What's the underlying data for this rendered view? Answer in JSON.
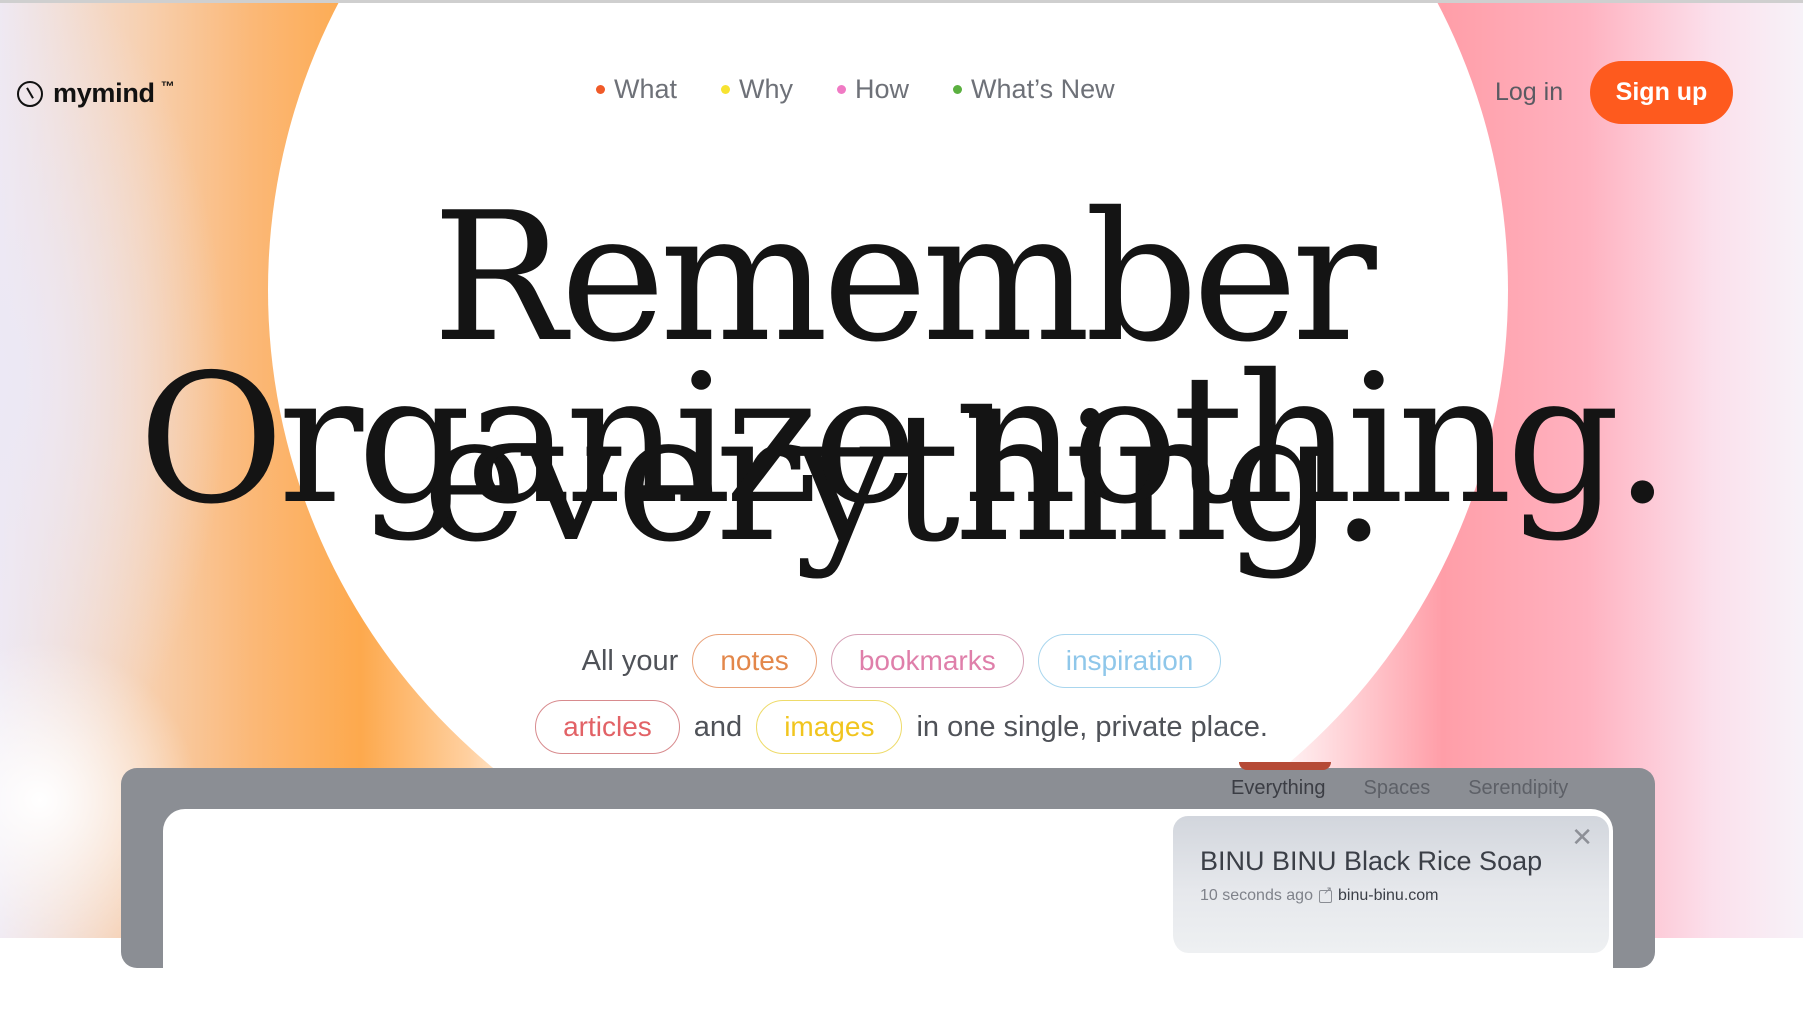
{
  "brand": {
    "name": "mymind",
    "tm": "™",
    "icon": "mind-clock-icon"
  },
  "nav": {
    "items": [
      {
        "label": "What",
        "dot_color": "#f05a28"
      },
      {
        "label": "Why",
        "dot_color": "#f7e331"
      },
      {
        "label": "How",
        "dot_color": "#f07ac4"
      },
      {
        "label": "What’s New",
        "dot_color": "#5bb040"
      }
    ]
  },
  "auth": {
    "login_label": "Log in",
    "signup_label": "Sign up",
    "accent": "#fe5a1e"
  },
  "hero": {
    "line1": "Remember everything.",
    "line2": "Organize nothing.",
    "sub_prefix": "All your",
    "sub_and": "and",
    "sub_suffix": "in one single, private place.",
    "pills": [
      {
        "label": "notes",
        "color": "#e3874a",
        "border": "#e9a27a"
      },
      {
        "label": "bookmarks",
        "color": "#df7faa",
        "border": "#d6a0b6"
      },
      {
        "label": "inspiration",
        "color": "#8fc7ea",
        "border": "#a9d6ee"
      },
      {
        "label": "articles",
        "color": "#e26266",
        "border": "#d88b8e"
      },
      {
        "label": "images",
        "color": "#f1c51e",
        "border": "#eedb6a"
      }
    ]
  },
  "app_preview": {
    "tabs": [
      "Everything",
      "Spaces",
      "Serendipity"
    ],
    "active_tab": "Everything",
    "card": {
      "title": "BINU BINU Black Rice Soap",
      "time": "10 seconds ago",
      "link": "binu-binu.com"
    }
  }
}
